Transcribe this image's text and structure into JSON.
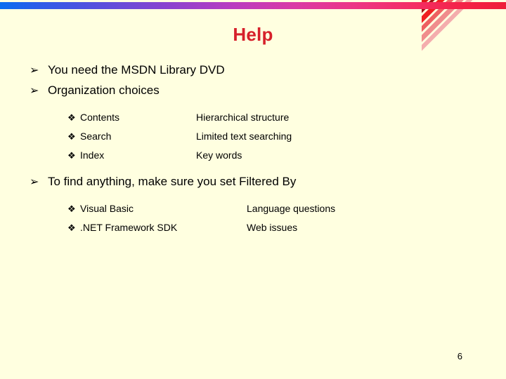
{
  "slide": {
    "title": "Help",
    "page_number": "6",
    "title_color": "#D6202A",
    "background_color": "#FFFFE0",
    "bullet_level1_glyph": "➢",
    "bullet_level2_glyph": "❖",
    "top_bar_gradient_from": "#0A6EF0",
    "top_bar_gradient_to": "#EE1E38"
  },
  "content": {
    "bullet1": "You need the MSDN Library DVD",
    "bullet2": "Organization choices",
    "group_a": [
      {
        "name": "Contents",
        "desc": "Hierarchical structure"
      },
      {
        "name": "Search",
        "desc": "Limited text searching"
      },
      {
        "name": "Index",
        "desc": "Key words"
      }
    ],
    "bullet3": "To find anything, make sure you set Filtered By",
    "group_b": [
      {
        "name": "Visual Basic",
        "desc": "Language questions"
      },
      {
        "name": ".NET Framework SDK",
        "desc": "Web issues"
      }
    ]
  }
}
